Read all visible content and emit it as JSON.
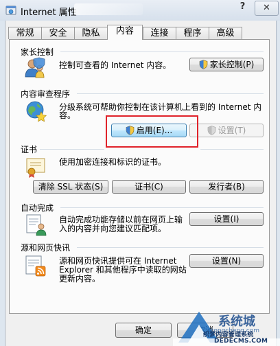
{
  "window": {
    "title": "Internet 属性",
    "help_label": "?",
    "close_label": "✕"
  },
  "tabs": [
    {
      "label": "常规"
    },
    {
      "label": "安全"
    },
    {
      "label": "隐私"
    },
    {
      "label": "内容",
      "active": true
    },
    {
      "label": "连接"
    },
    {
      "label": "程序"
    },
    {
      "label": "高级"
    }
  ],
  "parental": {
    "title": "家长控制",
    "description": "控制可查看的 Internet 内容。",
    "button": "家长控制(P)"
  },
  "advisor": {
    "title": "内容审查程序",
    "description_line1": "分级系统可帮助你控制在该计算机上看到的 Internet 内",
    "description_line2": "容。",
    "enable_button": "启用(E)...",
    "settings_button": "设置(T)"
  },
  "certificates": {
    "title": "证书",
    "description": "使用加密连接和标识的证书。",
    "clear_ssl_button": "清除 SSL 状态(S)",
    "certificates_button": "证书(C)",
    "publishers_button": "发行者(B)"
  },
  "autocomplete": {
    "title": "自动完成",
    "description_line1": "自动完成功能存储以前在网页上输",
    "description_line2": "入的内容并向您建议匹配项。",
    "settings_button": "设置(I)"
  },
  "feeds": {
    "title": "源和网页快讯",
    "description_line1": "源和网页快讯提供可在 Internet",
    "description_line2": "Explorer 和其他程序中读取的网站",
    "description_line3": "更新内容。",
    "settings_button": "设置(N)"
  },
  "footer": {
    "ok_button": "确定",
    "cancel_button": "取消"
  },
  "watermark": {
    "site_name": "织梦内容管理系统",
    "domain": "DEDECMS.COM",
    "brand": "系统城",
    "url": "xitongcheng.com"
  },
  "colors": {
    "highlight_box": "#e0222a",
    "accent": "#3c7fb1"
  }
}
